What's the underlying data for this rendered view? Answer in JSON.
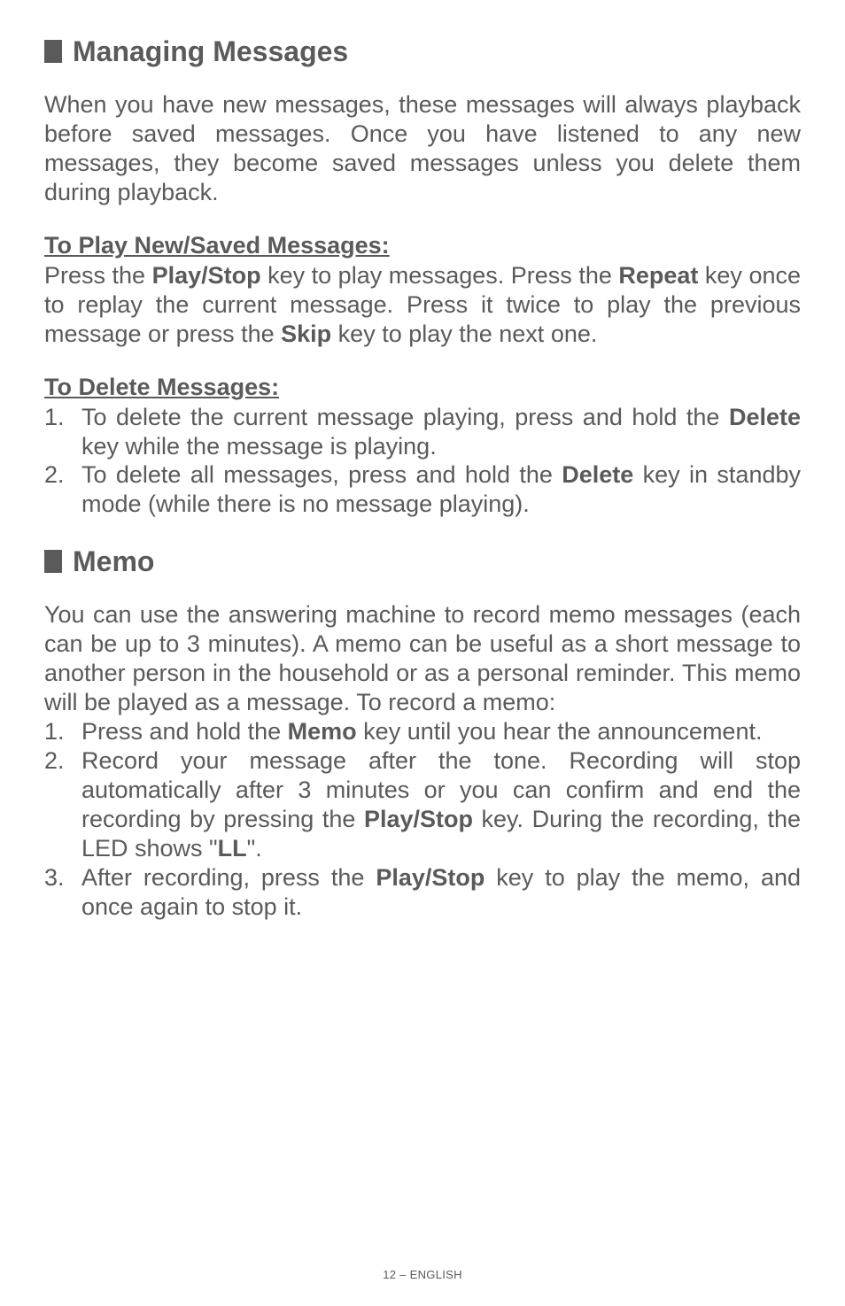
{
  "section1": {
    "title": "Managing Messages",
    "intro": "When you have new messages, these messages will always playback before saved messages.  Once you have listened to any new messages, they become saved messages unless you delete them during playback.",
    "play_heading": "To Play New/Saved Messages:",
    "play_para_pre": "Press the ",
    "play_key1": "Play/Stop",
    "play_para_mid1": " key to play messages.  Press the ",
    "play_key2": "Repeat",
    "play_para_mid2": " key once to replay the current message.  Press it twice to play the previous message or press the ",
    "play_key3": "Skip",
    "play_para_end": " key to play the next one.",
    "delete_heading": "To Delete Messages:",
    "del_items": [
      {
        "num": "1.",
        "pre": "To delete the current message playing, press and hold the ",
        "bold": "Delete",
        "post": " key while the message is playing."
      },
      {
        "num": "2.",
        "pre": "To delete all messages, press and hold the ",
        "bold": "Delete",
        "post": " key in standby mode (while there is no message playing)."
      }
    ]
  },
  "section2": {
    "title": "Memo",
    "intro": "You can use the answering machine to record memo messages (each can be up to 3 minutes). A memo can be useful as a short message to another person in the household or as a personal reminder.  This memo will be played as a message.  To record a memo:",
    "items": [
      {
        "num": "1.",
        "pre": "Press and hold the ",
        "b1": "Memo",
        "mid1": " key until you hear the announcement.",
        "b2": "",
        "mid2": "",
        "b3": "",
        "post": ""
      },
      {
        "num": "2.",
        "pre": "Record your message after the tone.  Recording will stop automatically after 3 minutes or you can confirm and end the recording by pressing the ",
        "b1": "Play/Stop",
        "mid1": " key.  During the recording, the LED shows \"",
        "b2": "LL",
        "mid2": "\".",
        "b3": "",
        "post": ""
      },
      {
        "num": "3.",
        "pre": "After recording, press the ",
        "b1": "Play/Stop",
        "mid1": " key to play the memo, and once again to stop it.",
        "b2": "",
        "mid2": "",
        "b3": "",
        "post": ""
      }
    ]
  },
  "footer": "12 – ENGLISH"
}
